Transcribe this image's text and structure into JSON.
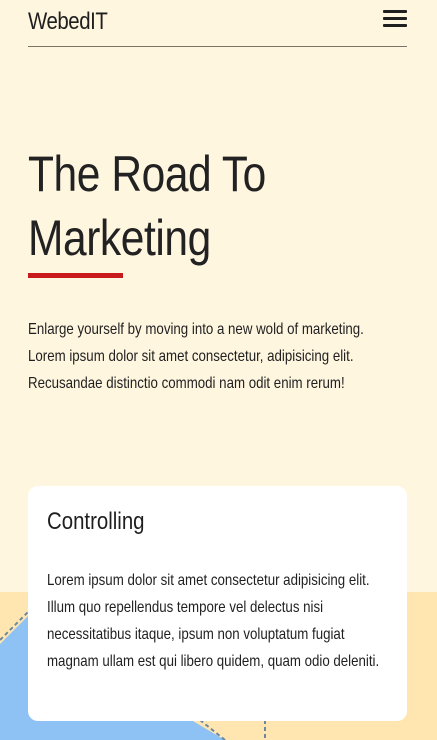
{
  "navbar": {
    "brand": "WebedIT",
    "menu_icon": "hamburger-menu-icon"
  },
  "hero": {
    "title_line1": "The Road To",
    "title_line2": "Marketing",
    "description": "Enlarge yourself by moving into a new wold of marketing. Lorem ipsum dolor sit amet consectetur, adipisicing elit. Recusandae distinctio commodi nam odit enim rerum!"
  },
  "card": {
    "title": "Controlling",
    "body": "Lorem ipsum dolor sit amet consectetur adipisicing elit. Illum quo repellendus tempore vel delectus nisi necessitatibus itaque, ipsum non voluptatum fugiat magnam ullam est qui libero quidem, quam odio deleniti."
  },
  "colors": {
    "page_background": "#fff6e0",
    "bottom_background": "#ffe6b0",
    "accent_blue": "#8ec2f5",
    "underline_red": "#c8191c",
    "card_background": "#ffffff"
  }
}
